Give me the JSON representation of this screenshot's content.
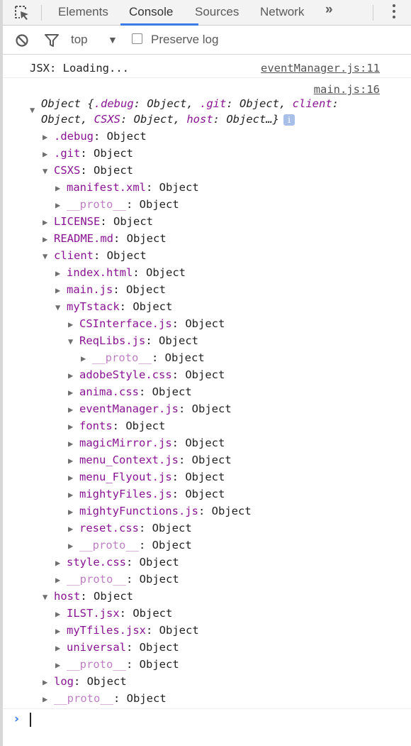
{
  "tabs": {
    "items": [
      "Elements",
      "Console",
      "Sources",
      "Network"
    ],
    "more": "»"
  },
  "toolbar": {
    "context": "top",
    "context_arrow": "▼",
    "preserve_log": "Preserve log"
  },
  "console": {
    "msg1": {
      "text": "JSX: Loading...",
      "source": "eventManager.js:11"
    },
    "msg2_source": "main.js:16",
    "object_header": {
      "line1_prefix": "Object {",
      "line1_keys": [
        ".debug",
        ".git",
        "client"
      ],
      "line2_keys": [
        "CSXS",
        "host"
      ],
      "val": "Object",
      "suffix": "…}",
      "badge": "i"
    },
    "tree": [
      {
        "depth": 0,
        "tri": "▶",
        "key": ".debug",
        "val": "Object"
      },
      {
        "depth": 0,
        "tri": "▶",
        "key": ".git",
        "val": "Object"
      },
      {
        "depth": 0,
        "tri": "▼",
        "key": "CSXS",
        "val": "Object"
      },
      {
        "depth": 1,
        "tri": "▶",
        "key": "manifest.xml",
        "val": "Object"
      },
      {
        "depth": 1,
        "tri": "▶",
        "key": "__proto__",
        "val": "Object",
        "proto": true
      },
      {
        "depth": 0,
        "tri": "▶",
        "key": "LICENSE",
        "val": "Object"
      },
      {
        "depth": 0,
        "tri": "▶",
        "key": "README.md",
        "val": "Object"
      },
      {
        "depth": 0,
        "tri": "▼",
        "key": "client",
        "val": "Object"
      },
      {
        "depth": 1,
        "tri": "▶",
        "key": "index.html",
        "val": "Object"
      },
      {
        "depth": 1,
        "tri": "▶",
        "key": "main.js",
        "val": "Object"
      },
      {
        "depth": 1,
        "tri": "▼",
        "key": "myTstack",
        "val": "Object"
      },
      {
        "depth": 2,
        "tri": "▶",
        "key": "CSInterface.js",
        "val": "Object"
      },
      {
        "depth": 2,
        "tri": "▼",
        "key": "ReqLibs.js",
        "val": "Object"
      },
      {
        "depth": 3,
        "tri": "▶",
        "key": "__proto__",
        "val": "Object",
        "proto": true
      },
      {
        "depth": 2,
        "tri": "▶",
        "key": "adobeStyle.css",
        "val": "Object"
      },
      {
        "depth": 2,
        "tri": "▶",
        "key": "anima.css",
        "val": "Object"
      },
      {
        "depth": 2,
        "tri": "▶",
        "key": "eventManager.js",
        "val": "Object"
      },
      {
        "depth": 2,
        "tri": "▶",
        "key": "fonts",
        "val": "Object"
      },
      {
        "depth": 2,
        "tri": "▶",
        "key": "magicMirror.js",
        "val": "Object"
      },
      {
        "depth": 2,
        "tri": "▶",
        "key": "menu_Context.js",
        "val": "Object"
      },
      {
        "depth": 2,
        "tri": "▶",
        "key": "menu_Flyout.js",
        "val": "Object"
      },
      {
        "depth": 2,
        "tri": "▶",
        "key": "mightyFiles.js",
        "val": "Object"
      },
      {
        "depth": 2,
        "tri": "▶",
        "key": "mightyFunctions.js",
        "val": "Object"
      },
      {
        "depth": 2,
        "tri": "▶",
        "key": "reset.css",
        "val": "Object"
      },
      {
        "depth": 2,
        "tri": "▶",
        "key": "__proto__",
        "val": "Object",
        "proto": true
      },
      {
        "depth": 1,
        "tri": "▶",
        "key": "style.css",
        "val": "Object"
      },
      {
        "depth": 1,
        "tri": "▶",
        "key": "__proto__",
        "val": "Object",
        "proto": true
      },
      {
        "depth": 0,
        "tri": "▼",
        "key": "host",
        "val": "Object"
      },
      {
        "depth": 1,
        "tri": "▶",
        "key": "ILST.jsx",
        "val": "Object"
      },
      {
        "depth": 1,
        "tri": "▶",
        "key": "myTfiles.jsx",
        "val": "Object"
      },
      {
        "depth": 1,
        "tri": "▶",
        "key": "universal",
        "val": "Object"
      },
      {
        "depth": 1,
        "tri": "▶",
        "key": "__proto__",
        "val": "Object",
        "proto": true
      },
      {
        "depth": 0,
        "tri": "▶",
        "key": "log",
        "val": "Object"
      },
      {
        "depth": 0,
        "tri": "▶",
        "key": "__proto__",
        "val": "Object",
        "proto": true
      }
    ],
    "prompt": "›"
  },
  "colors": {
    "accent": "#3b7be8",
    "key": "#881391"
  }
}
